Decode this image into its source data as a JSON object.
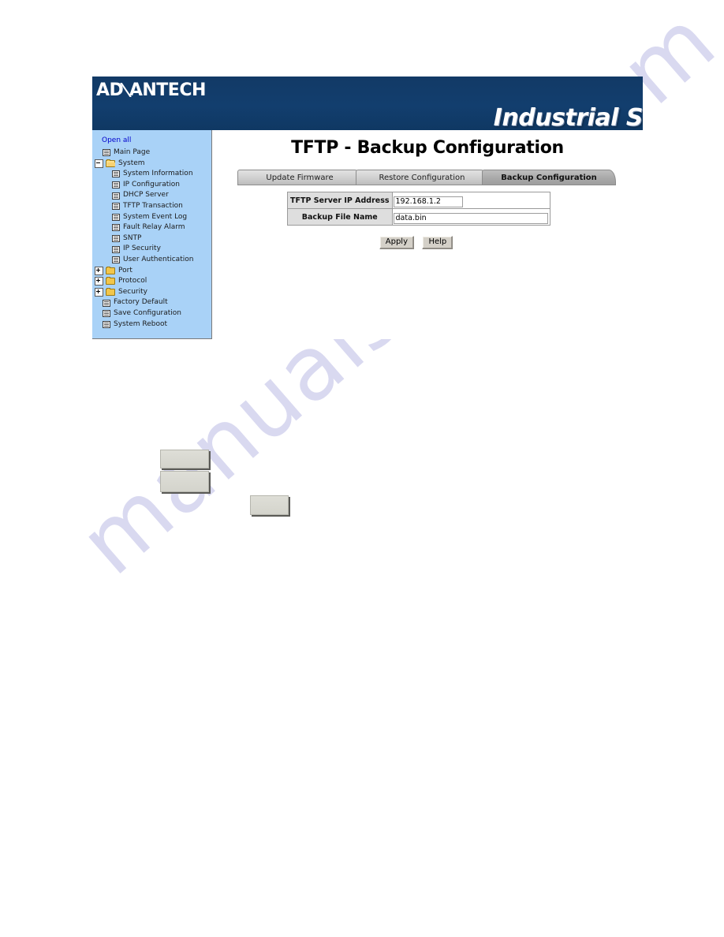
{
  "header": {
    "logo_text": "ADVANTECH",
    "brand_title": "Industrial S"
  },
  "sidebar": {
    "open_all_label": "Open all",
    "items": [
      {
        "label": "Main Page",
        "icon": "document-icon",
        "level": 0,
        "expander": "none"
      },
      {
        "label": "System",
        "icon": "folder-open-icon",
        "level": 1,
        "expander": "minus"
      },
      {
        "label": "System Information",
        "icon": "document-icon",
        "level": 2,
        "expander": "none"
      },
      {
        "label": "IP Configuration",
        "icon": "document-icon",
        "level": 2,
        "expander": "none"
      },
      {
        "label": "DHCP Server",
        "icon": "document-icon",
        "level": 2,
        "expander": "none"
      },
      {
        "label": "TFTP Transaction",
        "icon": "document-icon",
        "level": 2,
        "expander": "none"
      },
      {
        "label": "System Event Log",
        "icon": "document-icon",
        "level": 2,
        "expander": "none"
      },
      {
        "label": "Fault Relay Alarm",
        "icon": "document-icon",
        "level": 2,
        "expander": "none"
      },
      {
        "label": "SNTP",
        "icon": "document-icon",
        "level": 2,
        "expander": "none"
      },
      {
        "label": "IP Security",
        "icon": "document-icon",
        "level": 2,
        "expander": "none"
      },
      {
        "label": "User Authentication",
        "icon": "document-icon",
        "level": 2,
        "expander": "none"
      },
      {
        "label": "Port",
        "icon": "folder-closed-icon",
        "level": 1,
        "expander": "plus"
      },
      {
        "label": "Protocol",
        "icon": "folder-closed-icon",
        "level": 1,
        "expander": "plus"
      },
      {
        "label": "Security",
        "icon": "folder-closed-icon",
        "level": 1,
        "expander": "plus"
      },
      {
        "label": "Factory Default",
        "icon": "document-icon",
        "level": 0,
        "expander": "none"
      },
      {
        "label": "Save Configuration",
        "icon": "document-icon",
        "level": 0,
        "expander": "none"
      },
      {
        "label": "System Reboot",
        "icon": "document-icon",
        "level": 0,
        "expander": "none"
      }
    ]
  },
  "main": {
    "page_title": "TFTP - Backup Configuration",
    "tabs": [
      {
        "label": "Update Firmware",
        "active": false
      },
      {
        "label": "Restore Configuration",
        "active": false
      },
      {
        "label": "Backup Configuration",
        "active": true
      }
    ],
    "form": {
      "rows": [
        {
          "label": "TFTP Server IP Address",
          "value": "192.168.1.2"
        },
        {
          "label": "Backup File Name",
          "value": "data.bin"
        }
      ]
    },
    "buttons": [
      {
        "label": "Apply"
      },
      {
        "label": "Help"
      }
    ]
  },
  "watermark": {
    "text": "manualshive.com",
    "color": "#d9d9f0"
  },
  "colors": {
    "header_blue": "#123e6e",
    "sidebar_blue": "#a9d2f7",
    "link_blue": "#0000cd",
    "tab_inactive": "#cfcfcf",
    "tab_active": "#a8a8a8",
    "label_cell_gray": "#dedede",
    "button_face": "#d4d0c8"
  }
}
